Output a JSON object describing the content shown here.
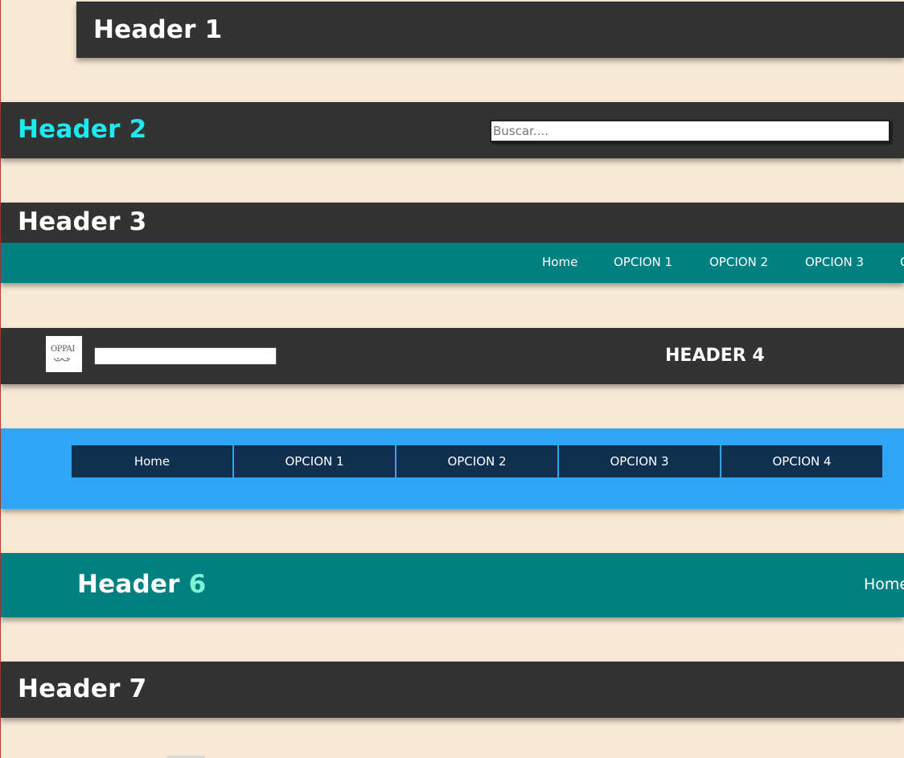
{
  "header1": {
    "title": "Header 1"
  },
  "header2": {
    "title": "Header 2",
    "search_placeholder": "Buscar...."
  },
  "header3": {
    "title": "Header 3",
    "nav": [
      "Home",
      "OPCION 1",
      "OPCION 2",
      "OPCION 3",
      "O"
    ]
  },
  "header4": {
    "logo_text": "OPPAI",
    "title": "HEADER 4"
  },
  "header5": {
    "tabs": [
      "Home",
      "OPCION 1",
      "OPCION 2",
      "OPCION 3",
      "OPCION 4"
    ]
  },
  "header6": {
    "title_part1": "Header ",
    "title_part2": "6",
    "nav_home": "Home"
  },
  "header7": {
    "title": "Header 7"
  },
  "colors": {
    "background": "#f8e9d6",
    "bar": "#333333",
    "teal": "#008080",
    "blue": "#2ea5f5",
    "navy": "#10304f",
    "cyan_title": "#1ee8f0",
    "mint_accent": "#7ff2d4"
  }
}
